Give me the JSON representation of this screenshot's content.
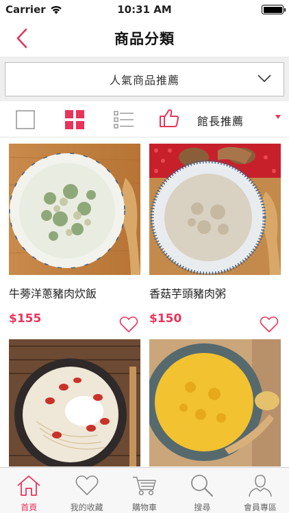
{
  "status_bar": {
    "carrier": "Carrier",
    "time": "10:31 AM",
    "battery_level": 1.0
  },
  "nav": {
    "title": "商品分類",
    "back_icon": "chevron-left-icon"
  },
  "filter": {
    "selected_category": "人氣商品推薦",
    "chevron_icon": "chevron-down-icon"
  },
  "view_toggle": {
    "options": [
      "single-view-icon",
      "grid-view-icon",
      "list-view-icon"
    ],
    "active": "grid-view-icon"
  },
  "sort": {
    "icon": "thumbs-up-icon",
    "label": "館長推薦"
  },
  "products": [
    {
      "name": "牛蒡洋蔥豬肉炊飯",
      "price": "$155",
      "image": "rice-bowl-photo",
      "favorite_icon": "heart-outline-icon"
    },
    {
      "name": "香菇芋頭豬肉粥",
      "price": "$150",
      "image": "congee-bowl-photo",
      "favorite_icon": "heart-outline-icon"
    },
    {
      "name": "",
      "price": "",
      "image": "noodle-soup-photo",
      "favorite_icon": "heart-outline-icon"
    },
    {
      "name": "",
      "price": "",
      "image": "millet-porridge-photo",
      "favorite_icon": "heart-outline-icon"
    }
  ],
  "tabs": [
    {
      "label": "首頁",
      "icon": "home-icon",
      "active": true
    },
    {
      "label": "我的收藏",
      "icon": "heart-icon",
      "active": false
    },
    {
      "label": "購物車",
      "icon": "cart-icon",
      "active": false
    },
    {
      "label": "搜尋",
      "icon": "search-icon",
      "active": false
    },
    {
      "label": "會員專區",
      "icon": "user-icon",
      "active": false
    }
  ],
  "colors": {
    "accent": "#e8335a",
    "inactive_icon": "#8a8a8a"
  }
}
